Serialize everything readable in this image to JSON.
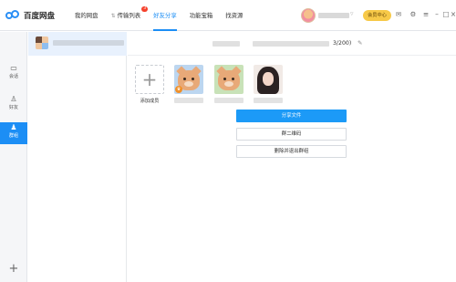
{
  "app": {
    "title": "百度网盘"
  },
  "nav": {
    "items": [
      {
        "label": "我的网盘",
        "active": false
      },
      {
        "label": "传输列表",
        "active": false,
        "badge": "3"
      },
      {
        "label": "好友分享",
        "active": true
      },
      {
        "label": "功能宝箱",
        "active": false
      },
      {
        "label": "找资源",
        "active": false
      }
    ]
  },
  "topbar": {
    "vip_label": "会员中心",
    "icons": [
      "mail-icon",
      "settings-icon",
      "menu-icon",
      "minimize-icon",
      "maximize-icon",
      "close-icon"
    ]
  },
  "rail": {
    "items": [
      {
        "label": "会话",
        "icon": "chat-icon"
      },
      {
        "label": "好友",
        "icon": "person-icon"
      },
      {
        "label": "群组",
        "icon": "group-icon",
        "active": true
      }
    ],
    "add_label": "+"
  },
  "group": {
    "member_count": "3/200)"
  },
  "members": {
    "add_label": "添加成员"
  },
  "actions": {
    "share_files": "分享文件",
    "qr_code": "群二维码",
    "delete_exit": "删除并退出群组"
  },
  "colors": {
    "accent": "#1c8ef5",
    "vip": "#f7c948",
    "badge": "#f5412c"
  }
}
